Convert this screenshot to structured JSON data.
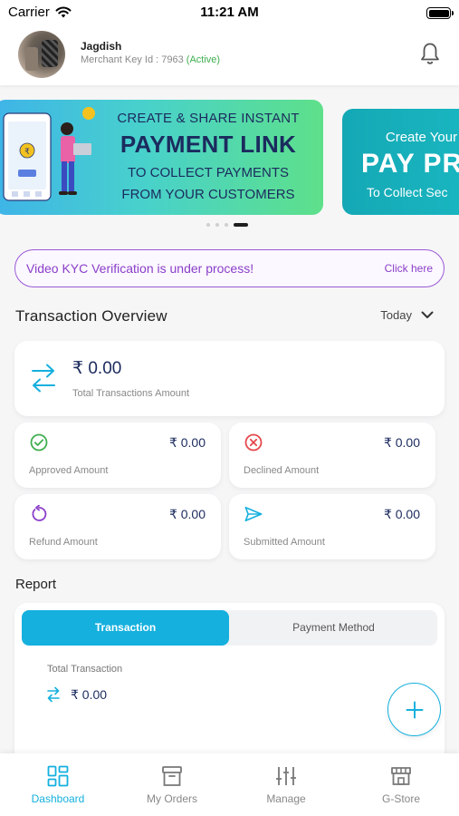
{
  "status_bar": {
    "carrier": "Carrier",
    "time": "11:21 AM"
  },
  "header": {
    "name": "Jagdish",
    "merchant_key_prefix": "Merchant Key Id : 7963 ",
    "status": "(Active)",
    "status_color": "#3fae4f",
    "notification_icon": "bell-icon"
  },
  "banners": [
    {
      "line1": "CREATE & SHARE INSTANT",
      "line2": "PAYMENT LINK",
      "line3": "TO COLLECT PAYMENTS",
      "line4": "FROM YOUR CUSTOMERS"
    },
    {
      "line1": "Create Your C",
      "line2": "PAY PR",
      "line3": "To Collect Sec"
    }
  ],
  "carousel": {
    "count": 4,
    "active_index": 3
  },
  "kyc": {
    "message": "Video KYC Verification is under process!",
    "action": "Click here",
    "color": "#8a3ec9"
  },
  "overview": {
    "title": "Transaction Overview",
    "period": "Today",
    "total": {
      "amount": "₹ 0.00",
      "label": "Total Transactions Amount"
    },
    "cards": [
      {
        "label": "Approved Amount",
        "amount": "₹ 0.00",
        "icon": "check-circle-icon",
        "color": "#3fae4f"
      },
      {
        "label": "Declined Amount",
        "amount": "₹ 0.00",
        "icon": "x-circle-icon",
        "color": "#e5484d"
      },
      {
        "label": "Refund Amount",
        "amount": "₹ 0.00",
        "icon": "refund-icon",
        "color": "#8a3ec9"
      },
      {
        "label": "Submitted Amount",
        "amount": "₹ 0.00",
        "icon": "send-icon",
        "color": "#15b0de"
      }
    ]
  },
  "report": {
    "title": "Report",
    "tabs": [
      "Transaction",
      "Payment Method"
    ],
    "active_tab": 0,
    "total_label": "Total Transaction",
    "total_amount": "₹ 0.00"
  },
  "accent_color": "#15b0de",
  "nav": {
    "items": [
      {
        "label": "Dashboard",
        "icon": "dashboard-icon",
        "active": true
      },
      {
        "label": "My Orders",
        "icon": "orders-icon",
        "active": false
      },
      {
        "label": "Manage",
        "icon": "sliders-icon",
        "active": false
      },
      {
        "label": "G-Store",
        "icon": "store-icon",
        "active": false
      }
    ]
  }
}
